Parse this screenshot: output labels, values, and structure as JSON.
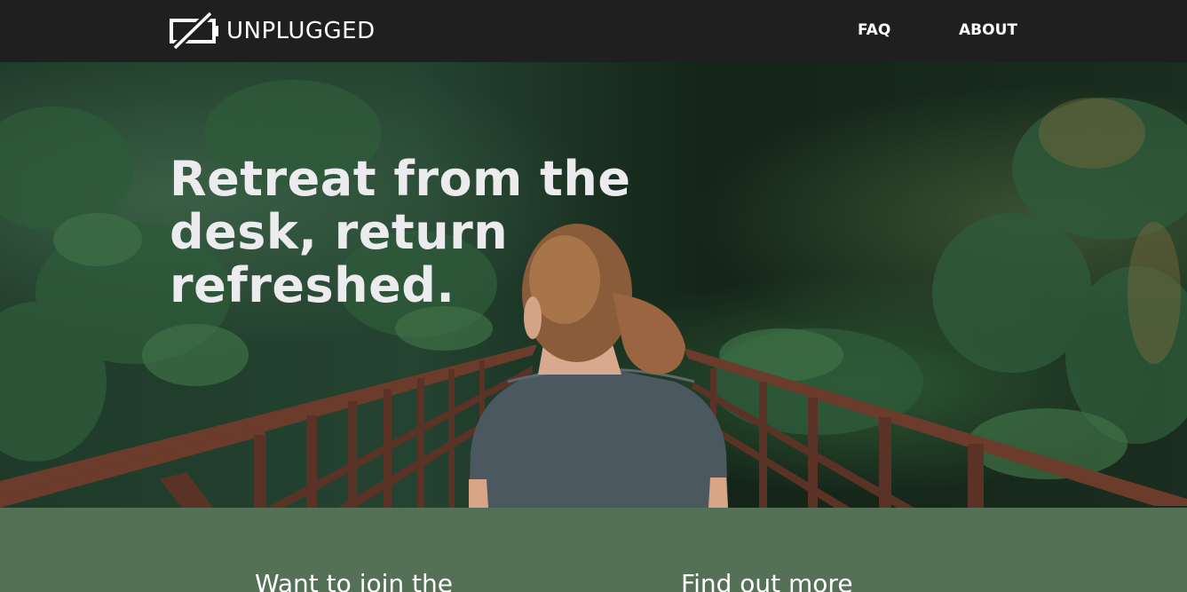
{
  "header": {
    "brand_name": "UNPLUGGED",
    "brand_icon": "battery-off-icon",
    "nav": [
      {
        "label": "FAQ"
      },
      {
        "label": "ABOUT"
      }
    ]
  },
  "hero": {
    "heading": "Retreat from the desk, return refreshed.",
    "image": "woman-on-forest-bridge-photo"
  },
  "cta": {
    "left_heading": "Want to join the",
    "right_heading": "Find out more"
  },
  "colors": {
    "topbar": "#1f1f1f",
    "accent_green": "#547158",
    "heading_text": "#ecebee"
  }
}
